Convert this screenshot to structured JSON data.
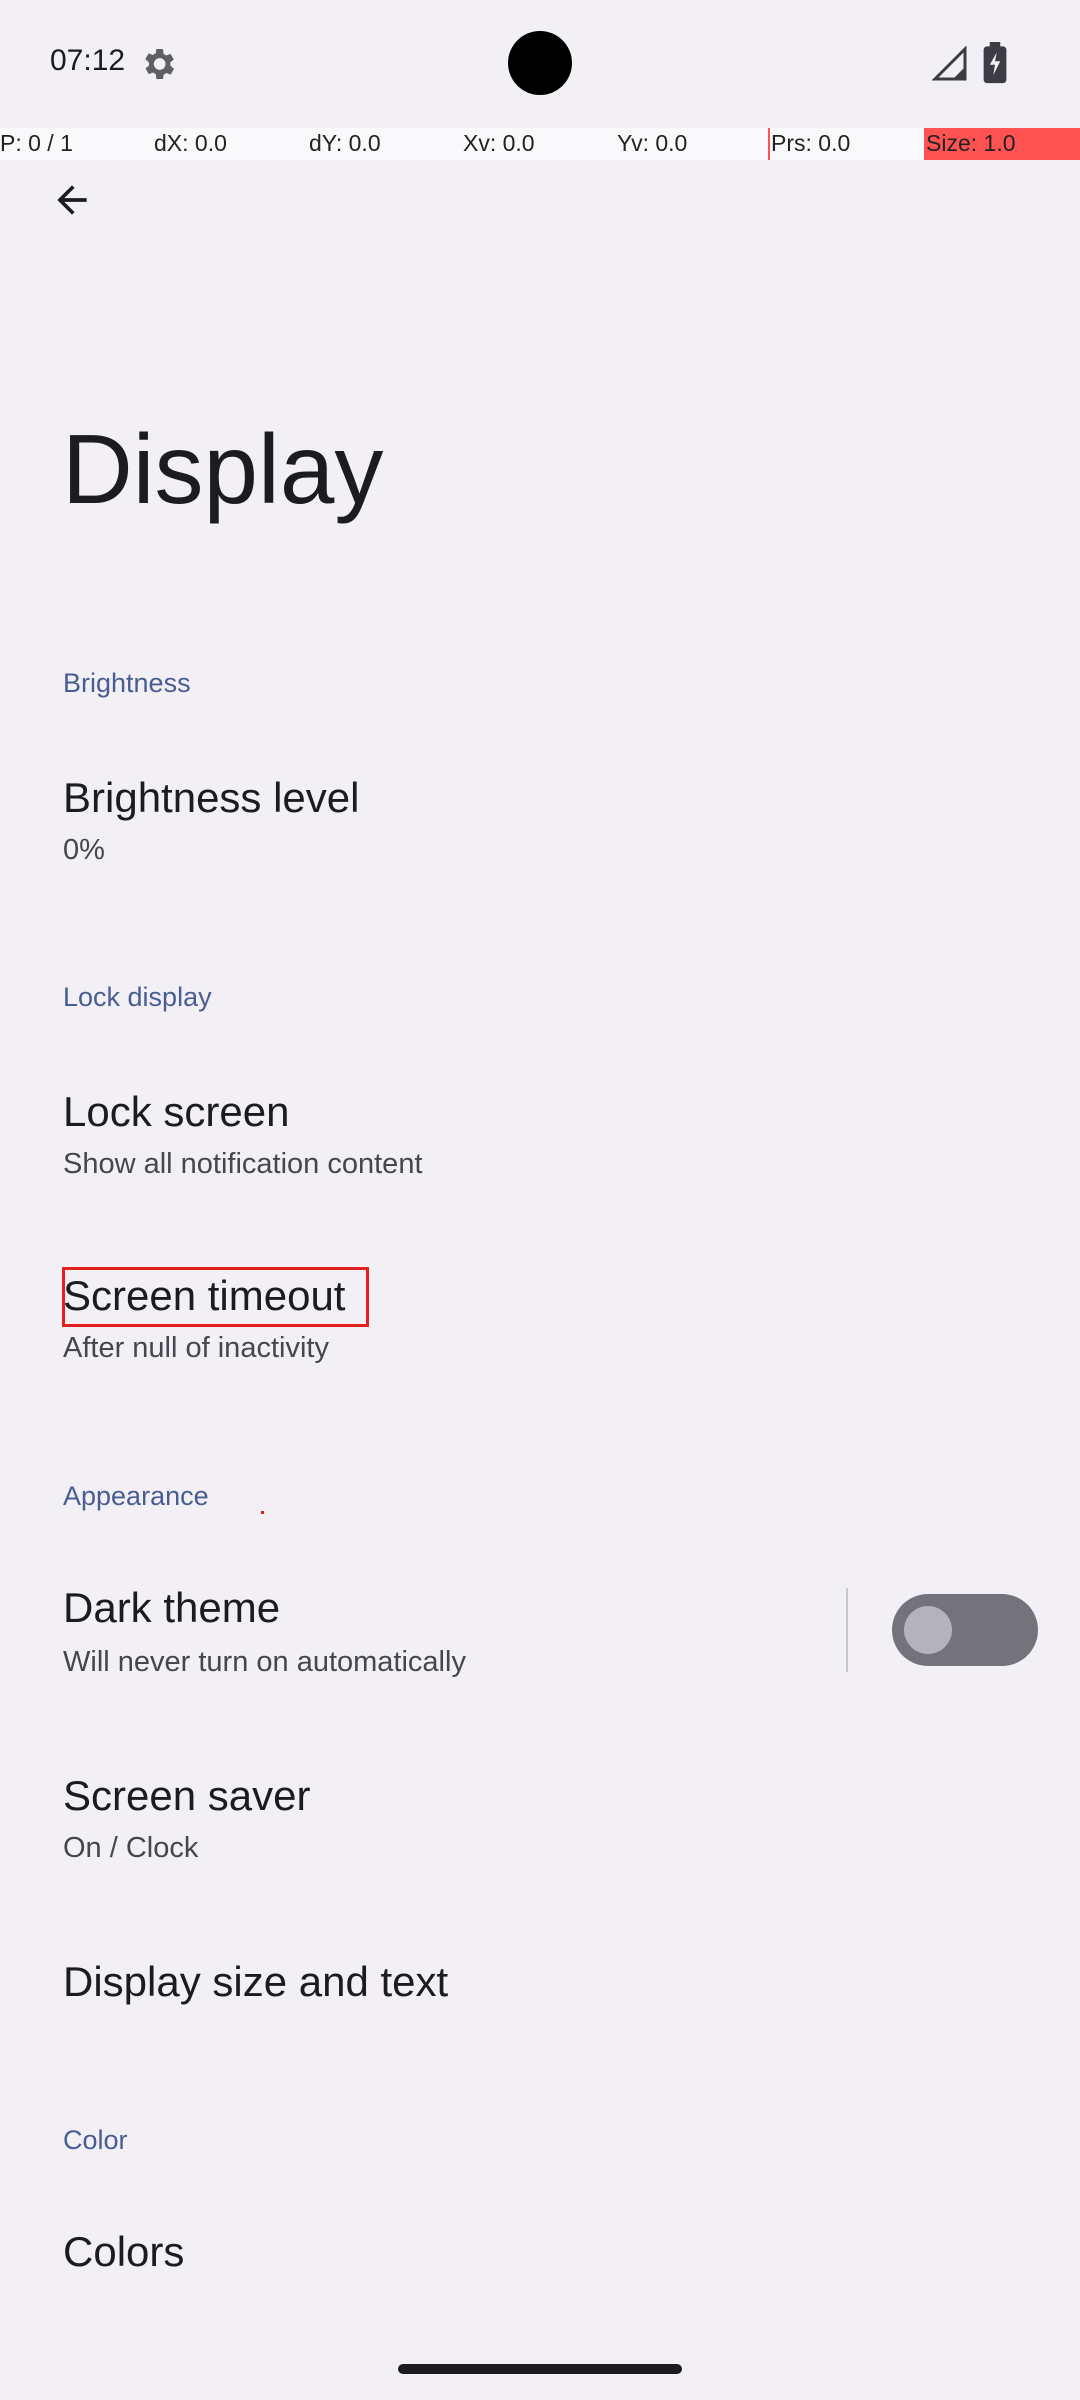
{
  "status_bar": {
    "time": "07:12",
    "icons": [
      "settings-gear-icon",
      "cell-signal-icon",
      "battery-charging-icon"
    ]
  },
  "debug_overlay": {
    "pointer": "P: 0 / 1",
    "dx": "dX: 0.0",
    "dy": "dY: 0.0",
    "xv": "Xv: 0.0",
    "yv": "Yv: 0.0",
    "prs": "Prs: 0.0",
    "size": "Size: 1.0"
  },
  "app_bar": {
    "back_icon": "arrow-back-icon",
    "title": "Display"
  },
  "sections": {
    "brightness": "Brightness",
    "lock_display": "Lock display",
    "appearance": "Appearance",
    "color": "Color"
  },
  "items": {
    "brightness_level": {
      "title": "Brightness level",
      "summary": "0%"
    },
    "lock_screen": {
      "title": "Lock screen",
      "summary": "Show all notification content"
    },
    "screen_timeout": {
      "title": "Screen timeout",
      "summary": "After null of inactivity"
    },
    "dark_theme": {
      "title": "Dark theme",
      "summary": "Will never turn on automatically",
      "enabled": false
    },
    "screen_saver": {
      "title": "Screen saver",
      "summary": "On / Clock"
    },
    "display_size": {
      "title": "Display size and text"
    },
    "colors": {
      "title": "Colors"
    }
  },
  "colors": {
    "background": "#f2eff5",
    "section_header": "#485d92",
    "highlight": "#e41f1f",
    "toggle_off_track": "#74737c"
  }
}
